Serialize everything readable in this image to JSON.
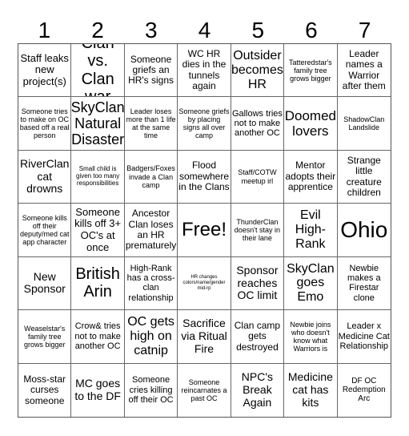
{
  "header": [
    "1",
    "2",
    "3",
    "4",
    "5",
    "6",
    "7"
  ],
  "cells": [
    "Staff leaks new project(s)",
    "Clan vs. Clan war",
    "Someone griefs an HR's signs",
    "WC HR dies in the tunnels again",
    "Outsider becomes HR",
    "Tatteredstar's family tree grows bigger",
    "Leader names a Warrior after them",
    "Someone tries to make on OC based off a real person",
    "SkyClan Natural Disaster",
    "Leader loses more than 1 life at the same time",
    "Someone griefs by placing signs all over camp",
    "Gallows tries not to make another OC",
    "Doomed lovers",
    "ShadowClan Landslide",
    "RiverClan cat drowns",
    "Small child is given too many responsibilities",
    "Badgers/Foxes invade a Clan camp",
    "Flood somewhere in the Clans",
    "Staff/COTW meetup irl",
    "Mentor adopts their apprentice",
    "Strange little creature children",
    "Someone kills off their deputy/med cat app character",
    "Someone kills off 3+ OC's at once",
    "Ancestor Clan loses an HR prematurely",
    "Free!",
    "ThunderClan doesn't stay in their lane",
    "Evil High-Rank",
    "Ohio",
    "New Sponsor",
    "British Arin",
    "High-Rank has a cross-clan relationship",
    "HR changes colors/name/gender mid-rp",
    "Sponsor reaches OC limit",
    "SkyClan goes Emo",
    "Newbie makes a Firestar clone",
    "Weaselstar's family tree grows bigger",
    "Crow& tries not to make another OC",
    "OC gets high on catnip",
    "Sacrifice via Ritual Fire",
    "Clan camp gets destroyed",
    "Newbie joins who doesn't know what Warriors is",
    "Leader x Medicine Cat Relationship",
    "Moss-star curses someone",
    "MC goes to the DF",
    "Someone cries killing off their OC",
    "Someone reincarnates a past OC",
    "NPC's Break Again",
    "Medicine cat has kits",
    "DF OC Redemption Arc"
  ]
}
